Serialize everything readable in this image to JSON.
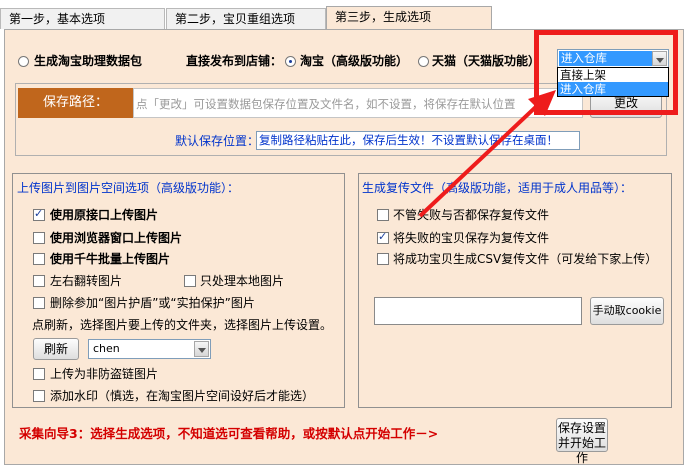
{
  "tabs": [
    {
      "label": "第一步，基本选项"
    },
    {
      "label": "第二步，宝贝重组选项"
    },
    {
      "label": "第三步，生成选项"
    }
  ],
  "top": {
    "radio_package": "生成淘宝助理数据包",
    "publish_label": "直接发布到店铺：",
    "radio_taobao": "淘宝（高级版功能）",
    "radio_tmall": "天猫（天猫版功能）",
    "store_select": {
      "value": "进入仓库",
      "options": [
        "直接上架",
        "进入仓库"
      ]
    }
  },
  "save": {
    "label": "保存路径：",
    "placeholder": "点「更改」可设置数据包保存位置及文件名，如不设置，将保存在默认位置",
    "change_button": "更改",
    "default_label": "默认保存位置：",
    "default_link": "复制路径粘贴在此，保存后生效！不设置默认保存在桌面！"
  },
  "upload": {
    "title": "上传图片到图片空间选项（高级版功能）：",
    "opt1": "使用原接口上传图片",
    "opt2": "使用浏览器窗口上传图片",
    "opt3": "使用千牛批量上传图片",
    "opt4": "左右翻转图片",
    "opt5": "只处理本地图片",
    "opt6": "删除参加“图片护盾”或“实拍保护”图片",
    "hint": "点刷新，选择图片要上传的文件夹，选择图片上传设置。",
    "refresh_button": "刷新",
    "folder_value": "chen",
    "opt7": "上传为非防盗链图片",
    "opt8": "添加水印（慎选，在淘宝图片空间设好后才能选）"
  },
  "copy": {
    "title": "生成复传文件（高级版功能，适用于成人用品等）：",
    "opt1": "不管失败与否都保存复传文件",
    "opt2": "将失败的宝贝保存为复传文件",
    "opt3": "将成功宝贝生成CSV复传文件（可发给下家上传）",
    "cookie_value": "",
    "cookie_button": "手动取cookie"
  },
  "footer": {
    "wizard_text": "采集向导3：选择生成选项，不知道选可查看帮助，或按默认点开始工作－>",
    "start_button": "保存设置并开始工作"
  },
  "colors": {
    "panel_bg": "#fbe8d6",
    "save_label_bg": "#c0661c",
    "wizard_red": "#d40000",
    "annotation_red": "#ee1c1c",
    "link_blue": "#0033cc",
    "select_blue": "#3399ff"
  }
}
